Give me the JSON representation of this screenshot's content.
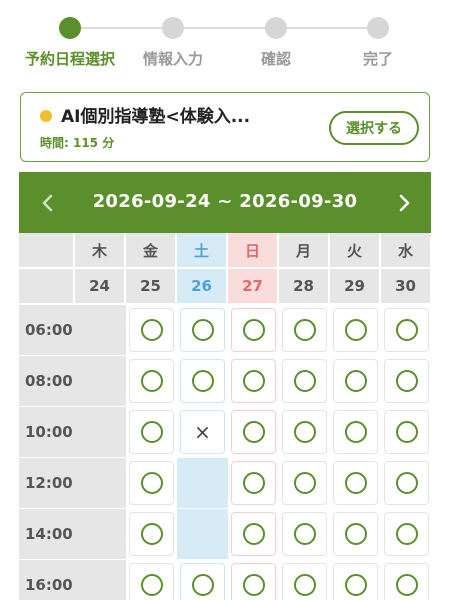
{
  "stepper": {
    "steps": [
      {
        "label": "予約日程選択",
        "active": true
      },
      {
        "label": "情報入力",
        "active": false
      },
      {
        "label": "確認",
        "active": false
      },
      {
        "label": "完了",
        "active": false
      }
    ]
  },
  "course": {
    "title": "AI個別指導塾<体験入...",
    "time": "時間: 115 分",
    "select_label": "選択する"
  },
  "calendar": {
    "range": "2026-09-24 ~ 2026-09-30",
    "days": [
      {
        "weekday": "木",
        "date": "24",
        "type": "weekday"
      },
      {
        "weekday": "金",
        "date": "25",
        "type": "weekday"
      },
      {
        "weekday": "土",
        "date": "26",
        "type": "sat"
      },
      {
        "weekday": "日",
        "date": "27",
        "type": "sun"
      },
      {
        "weekday": "月",
        "date": "28",
        "type": "weekday"
      },
      {
        "weekday": "火",
        "date": "29",
        "type": "weekday"
      },
      {
        "weekday": "水",
        "date": "30",
        "type": "weekday"
      }
    ],
    "slots": [
      {
        "time": "06:00",
        "status": [
          "blank",
          "available",
          "available",
          "available",
          "available",
          "available",
          "available"
        ]
      },
      {
        "time": "08:00",
        "status": [
          "blank",
          "available",
          "available",
          "available",
          "available",
          "available",
          "available"
        ]
      },
      {
        "time": "10:00",
        "status": [
          "blank",
          "available",
          "unavailable",
          "available",
          "available",
          "available",
          "available"
        ]
      },
      {
        "time": "12:00",
        "status": [
          "blank",
          "available",
          "blank",
          "available",
          "available",
          "available",
          "available"
        ]
      },
      {
        "time": "14:00",
        "status": [
          "blank",
          "available",
          "blank",
          "available",
          "available",
          "available",
          "available"
        ]
      },
      {
        "time": "16:00",
        "status": [
          "blank",
          "available",
          "available",
          "available",
          "available",
          "available",
          "available"
        ]
      }
    ],
    "symbols": {
      "unavailable": "×"
    }
  },
  "colors": {
    "accent": "#5a8f2c",
    "saturday": "#4aa3d8",
    "sunday": "#e06a6a",
    "course_dot": "#f0c030"
  },
  "icons": {
    "prev": "chevron-left-icon",
    "next": "chevron-right-icon",
    "available": "circle-icon",
    "unavailable": "cross-icon"
  }
}
